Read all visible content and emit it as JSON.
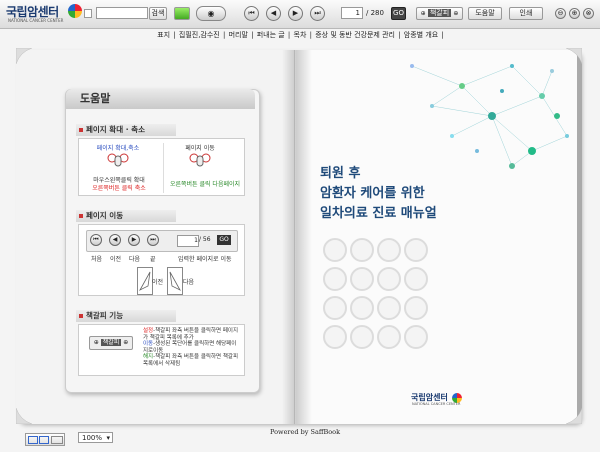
{
  "toolbar": {
    "logo_text": "국립암센터",
    "logo_sub": "NATIONAL CANCER CENTER",
    "search_label": "검색",
    "nav_first": "⏮",
    "nav_prev": "◀",
    "nav_next": "▶",
    "nav_last": "⏭",
    "current_page": "1",
    "total_pages": "/ 280",
    "go_label": "GO",
    "bookmark_label": "책갈피",
    "help_label": "도움말",
    "print_label": "인쇄",
    "win_min": "⊖",
    "win_max": "⊕",
    "win_close": "⊗"
  },
  "navbar": {
    "items": [
      "표지",
      "집필진,감수진",
      "머리말",
      "퍼내는 글",
      "목차",
      "증상 및 동반 건강문제 관리",
      "암종별 개요"
    ]
  },
  "help": {
    "title": "도움말",
    "section1": "페이지 확대 · 축소",
    "zoom_label": "페이지 확대,축소",
    "zoom_desc_1": "마우스왼쪽클릭 확대",
    "zoom_desc_2": "오른쪽버튼 클릭 축소",
    "move_label": "페이지 이동",
    "move_desc": "오른쪽버튼 클릭 다음페이지",
    "section2": "페이지 이동",
    "page_input": "1",
    "page_total": "/ 56",
    "go_label": "GO",
    "nav_labels": [
      "처음",
      "이전",
      "다음",
      "끝"
    ],
    "nav_input_desc": "입력한 페이지로 이동",
    "prev_label": "이전",
    "next_label": "다음",
    "section3": "책갈피 기능",
    "bm_label": "책갈피",
    "bm_lines": [
      {
        "key": "설정",
        "text": "-책갈피 좌측 버튼을 클릭하면 페이지가 책갈피 목록에 추가"
      },
      {
        "key": "이동",
        "text": "-생성된 목단어를 클릭하면 해당페이지로이동"
      },
      {
        "key": "해지",
        "text": "-책갈피 좌측 버튼을 클릭하면 책갈피목록에서 삭제됨"
      }
    ]
  },
  "cover": {
    "title_lines": [
      "퇴원 후",
      "암환자 케어를 위한",
      "일차의료 진료 매뉴얼"
    ],
    "publisher": "국립암센터",
    "publisher_sub": "NATIONAL CANCER CENTER"
  },
  "footer": {
    "powered": "Powered by SaffBook",
    "zoom": "100%"
  }
}
